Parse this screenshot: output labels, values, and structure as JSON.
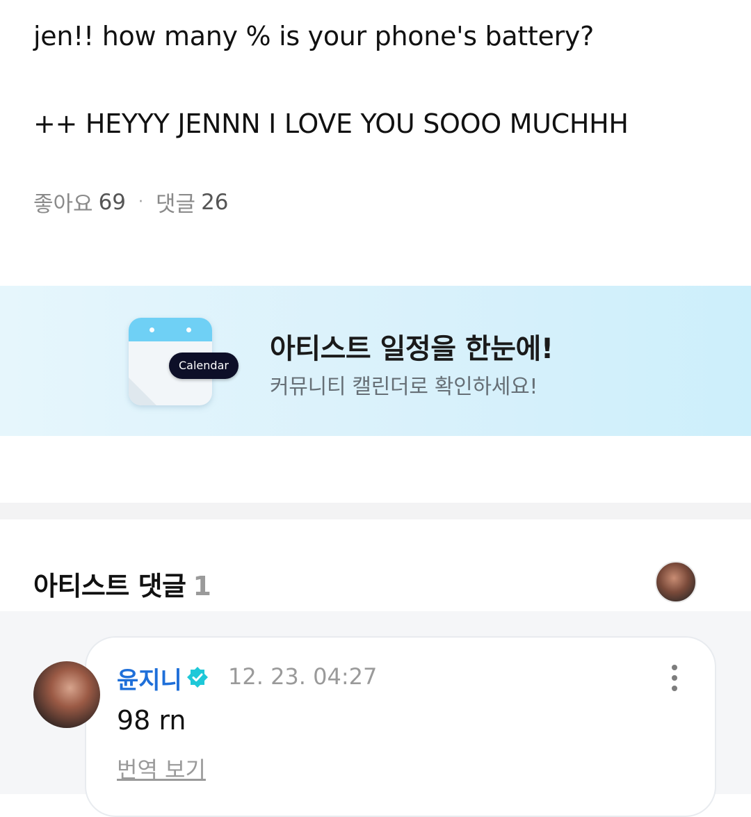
{
  "post": {
    "line1": "jen!! how many % is your phone's battery?",
    "line2": "++ HEYYY JENNN I LOVE YOU SOOO MUCHHH",
    "likes_label": "좋아요",
    "likes_count": "69",
    "separator": "·",
    "comments_label": "댓글",
    "comments_count": "26"
  },
  "banner": {
    "badge": "Calendar",
    "title": "아티스트 일정을 한눈에!",
    "subtitle": "커뮤니티 캘린더로 확인하세요!",
    "colors": {
      "top": "#6fd0f5",
      "badge_bg": "#0d0f28"
    }
  },
  "artist_comments": {
    "title": "아티스트 댓글",
    "count": "1",
    "items": [
      {
        "author": "윤지니",
        "timestamp": "12. 23. 04:27",
        "text": "98 rn",
        "translate": "번역 보기"
      }
    ]
  },
  "colors": {
    "author": "#1e6fd9",
    "verified": "#1ec8d8"
  },
  "icons": {
    "verified": "verified-badge-icon",
    "more": "more-vertical-icon",
    "calendar": "calendar-icon"
  }
}
